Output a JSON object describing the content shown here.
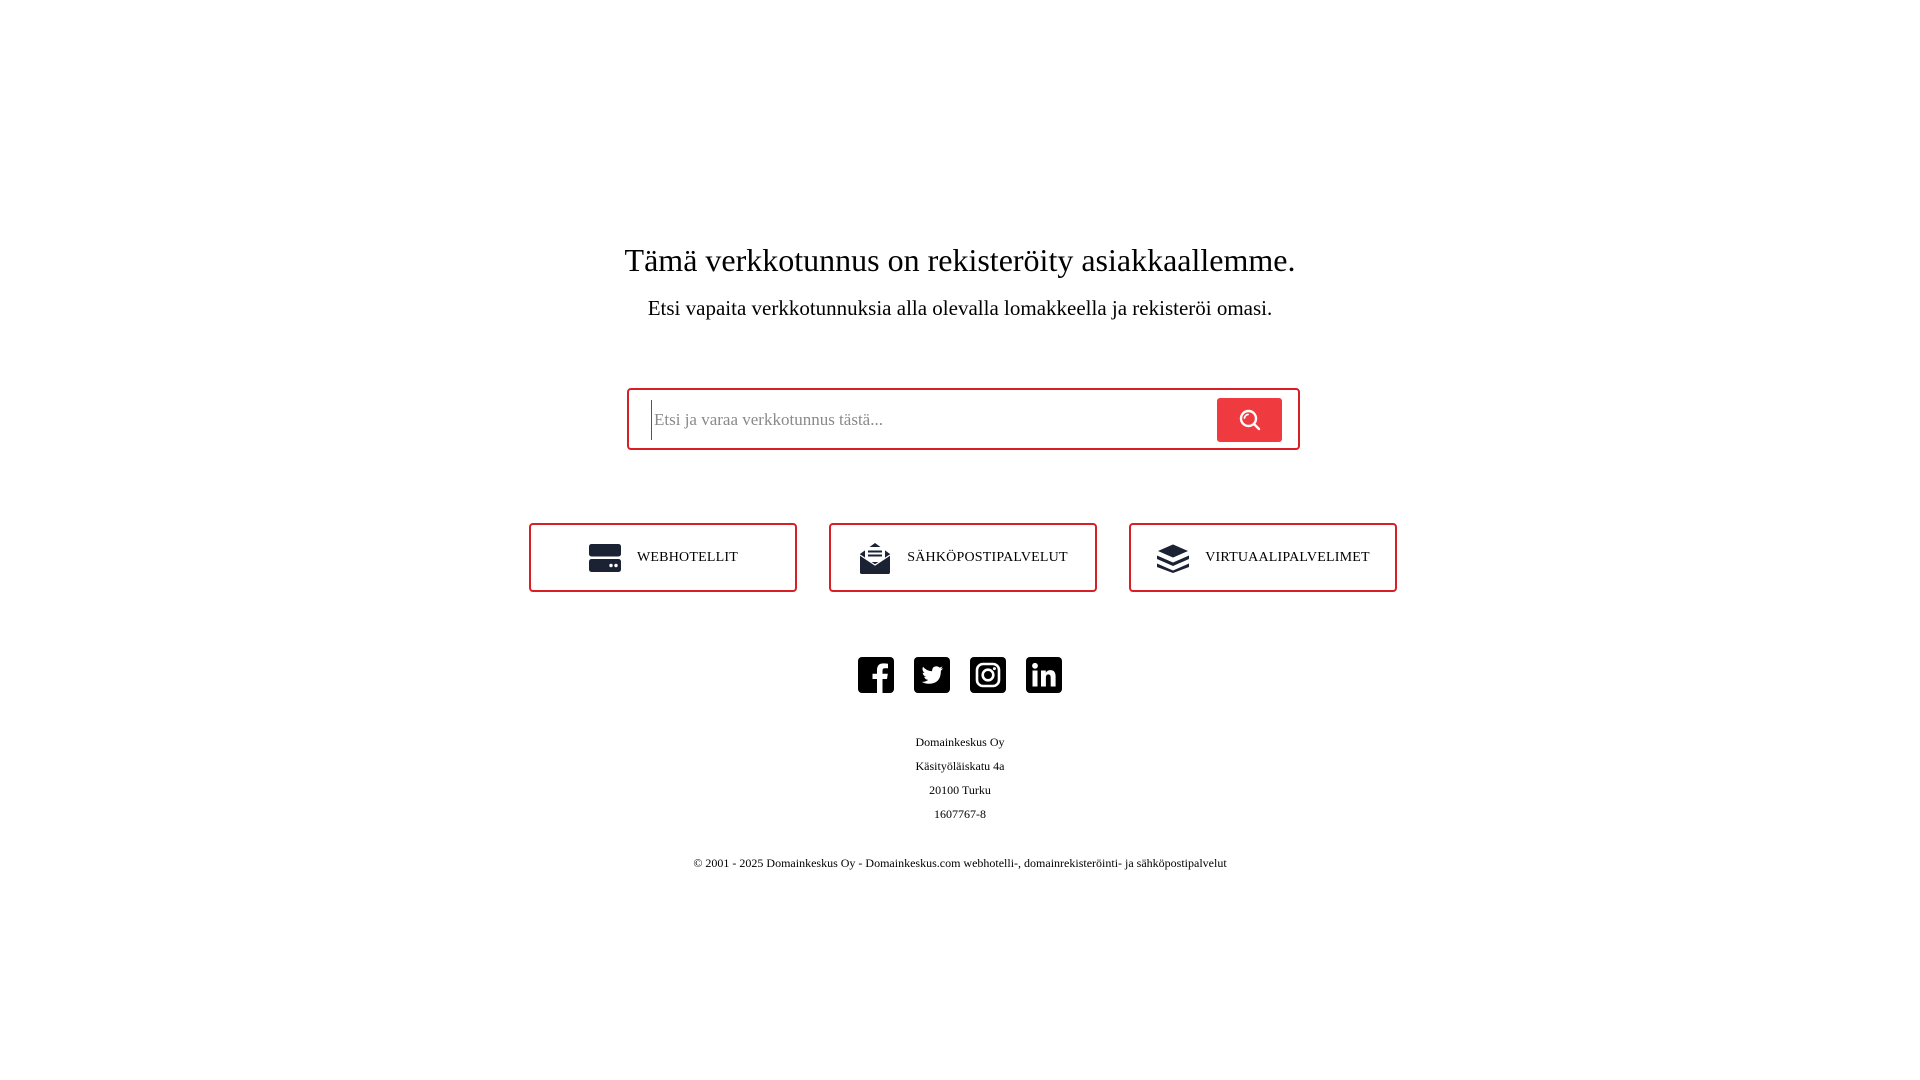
{
  "hero": {
    "title": "Tämä verkkotunnus on rekisteröity asiakkaallemme.",
    "subtitle": "Etsi vapaita verkkotunnuksia alla olevalla lomakkeella ja rekisteröi omasi."
  },
  "search": {
    "placeholder": "Etsi ja varaa verkkotunnus tästä...",
    "value": "",
    "button_icon": "search-icon"
  },
  "services": [
    {
      "label": "WEBHOTELLIT",
      "icon": "server-icon"
    },
    {
      "label": "SÄHKÖPOSTIPALVELUT",
      "icon": "envelope-open-icon"
    },
    {
      "label": "VIRTUAALIPALVELIMET",
      "icon": "layers-icon"
    }
  ],
  "socials": [
    {
      "icon": "facebook-icon"
    },
    {
      "icon": "twitter-icon"
    },
    {
      "icon": "instagram-icon"
    },
    {
      "icon": "linkedin-icon"
    }
  ],
  "company": {
    "name": "Domainkeskus Oy",
    "street": "Käsityöläiskatu 4a",
    "city": "20100 Turku",
    "business_id": "1607767-8"
  },
  "footer": {
    "copyright": "© 2001 - 2025 Domainkeskus Oy - Domainkeskus.com webhotelli-, domainrekisteröinti- ja sähköpostipalvelut"
  },
  "colors": {
    "accent_border": "#d81f26",
    "search_button": "#ef3a3f",
    "icon_dark": "#1a2233"
  }
}
